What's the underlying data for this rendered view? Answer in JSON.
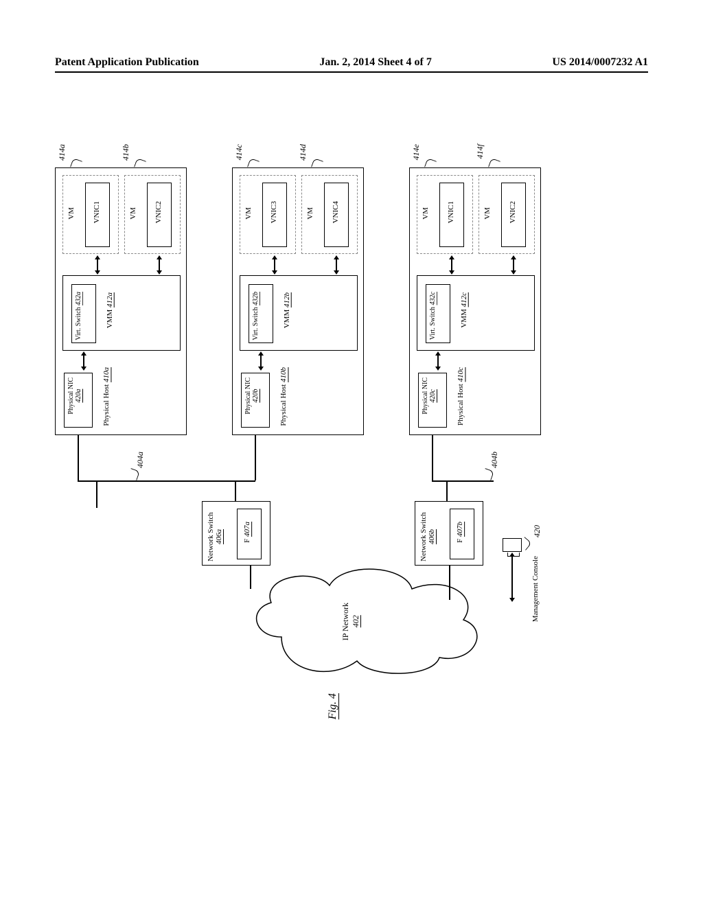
{
  "header": {
    "left": "Patent Application Publication",
    "center": "Jan. 2, 2014  Sheet 4 of 7",
    "right": "US 2014/0007232 A1"
  },
  "figure_label": "Fig. 4",
  "refs": {
    "r414a": "414a",
    "r414b": "414b",
    "r414c": "414c",
    "r414d": "414d",
    "r414e": "414e",
    "r414f": "414f",
    "r404a": "404a",
    "r404b": "404b",
    "r420": "420"
  },
  "hosts": [
    {
      "host_label": "Physical Host",
      "host_ref": "410a",
      "vmm_label": "VMM",
      "vmm_ref": "412a",
      "vswitch": "Virt. Switch",
      "vswitch_ref": "432a",
      "nic": "Physical NIC",
      "nic_ref": "420a",
      "vm1": {
        "vm": "VM",
        "vnic": "VNIC1"
      },
      "vm2": {
        "vm": "VM",
        "vnic": "VNIC2"
      }
    },
    {
      "host_label": "Physical Host",
      "host_ref": "410b",
      "vmm_label": "VMM",
      "vmm_ref": "412b",
      "vswitch": "Virt. Switch",
      "vswitch_ref": "432b",
      "nic": "Physical NIC",
      "nic_ref": "420b",
      "vm1": {
        "vm": "VM",
        "vnic": "VNIC3"
      },
      "vm2": {
        "vm": "VM",
        "vnic": "VNIC4"
      }
    },
    {
      "host_label": "Physical Host",
      "host_ref": "410c",
      "vmm_label": "VMM",
      "vmm_ref": "412c",
      "vswitch": "Virt. Switch",
      "vswitch_ref": "432c",
      "nic": "Physical NIC",
      "nic_ref": "420c",
      "vm1": {
        "vm": "VM",
        "vnic": "VNIC1"
      },
      "vm2": {
        "vm": "VM",
        "vnic": "VNIC2"
      }
    }
  ],
  "switches": [
    {
      "label": "Network Switch",
      "ref": "406a",
      "f_label": "F",
      "f_ref": "407a"
    },
    {
      "label": "Network Switch",
      "ref": "406b",
      "f_label": "F",
      "f_ref": "407b"
    }
  ],
  "network": {
    "label": "IP Network",
    "ref": "402"
  },
  "console": {
    "label": "Management Console"
  }
}
